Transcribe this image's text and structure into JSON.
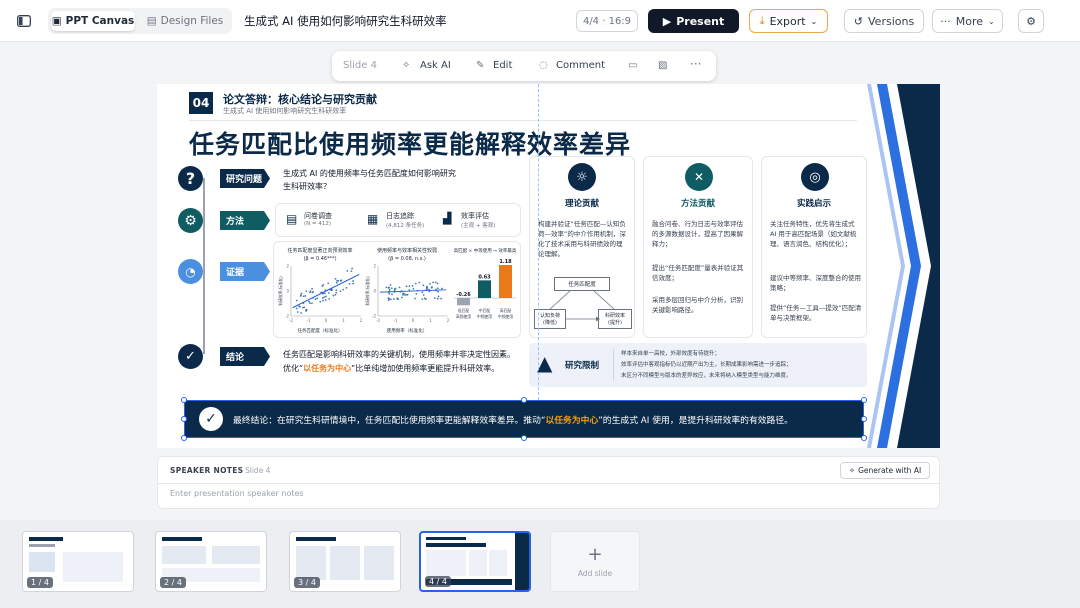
{
  "topbar": {
    "tab_canvas": "PPT Canvas",
    "tab_design": "Design Files",
    "doc_title": "生成式 AI 使用如何影响研究生科研效率",
    "page_info": "4/4 · 16:9",
    "present": "Present",
    "export": "Export",
    "versions": "Versions",
    "more": "More"
  },
  "toolbar": {
    "slide": "Slide 4",
    "ask": "Ask AI",
    "edit": "Edit",
    "comment": "Comment"
  },
  "slide": {
    "num": "04",
    "header_title": "论文答辩：核心结论与研究贡献",
    "header_sub": "生成式 AI 使用如何影响研究生科研效率",
    "main_title": "任务匹配比使用频率更能解释效率差异",
    "q_tag": "研究问题",
    "q_text": "生成式 AI 的使用频率与任务匹配度如何影响研究生科研效率？",
    "m_tag": "方法",
    "m1_title": "问卷调查",
    "m1_sub": "(N = 412)",
    "m2_title": "日志追踪",
    "m2_sub": "(4,812 条任务)",
    "m3_title": "效率评估",
    "m3_sub": "(主观 + 客观)",
    "e_tag": "证据",
    "ch1_title": "任务匹配度显著正向预测效率",
    "ch1_beta": "(β = 0.46***)",
    "ch1_x": "任务匹配度（标准化）",
    "ch1_y": "科研效率(标准化)",
    "ch2_title": "使用频率与效率相关性较弱",
    "ch2_beta": "(β = 0.08, n.s.)",
    "ch2_x": "使用频率（标准化）",
    "ch2_y": "科研效率(标准化)",
    "ch3_title": "高匹配 × 中等使用 → 效率最高",
    "c_tag": "结论",
    "c_text1": "任务匹配是影响科研效率的关键机制，使用频率并非决定性因素。",
    "c_text2a": "优化“",
    "c_text2b": "以任务为中心",
    "c_text2c": "”比单纯增加使用频率更能提升科研效率。",
    "t_title": "理论贡献",
    "t_text": "构建并验证“任务匹配—认知负荷—效率”的中介作用机制，深化了技术采用与科研绩效的理论理解。",
    "t_d1": "任务匹配度",
    "t_d2": "认知负荷\n(降低)",
    "t_d3": "科研效率\n(提升)",
    "mc_title": "方法贡献",
    "mc_1": "融合问卷、行为日志与效率评估的多源数据设计，提高了因果解释力；",
    "mc_2": "提出“任务匹配度”量表并验证其信效度；",
    "mc_3": "采用多层回归与中介分析，识别关键影响路径。",
    "p_title": "实践启示",
    "p_1": "关注任务特性，优先将生成式 AI 用于高匹配场景（如文献梳理、语言润色、结构优化）；",
    "p_2": "建议中等频率、深度整合的使用策略；",
    "p_3": "提供“任务—工具—提效”匹配清单与决策框架。",
    "lim_title": "研究限制",
    "lim_1": "样本来自单一高校，外部效度有待提升；",
    "lim_2": "效率评估中客观指标仍以近期产出为主，长期成果影响需进一步追踪；",
    "lim_3": "未区分不同模型与版本的差异效应，未来将纳入模型类型与能力维度。",
    "final_a": "最终结论：在研究生科研情境中，任务匹配比使用频率更能解释效率差异。推动“",
    "final_b": "以任务为中心",
    "final_c": "”的生成式 AI 使用，是提升科研效率的有效路径。"
  },
  "chart_data": [
    {
      "type": "scatter",
      "title": "任务匹配度显著正向预测效率",
      "subtitle": "(β = 0.46***)",
      "xlabel": "任务匹配度（标准化）",
      "ylabel": "科研效率(标准化)",
      "xlim": [
        -2,
        2
      ],
      "ylim": [
        -2,
        2
      ],
      "x_ticks": [
        -2,
        -1,
        0,
        1,
        2
      ],
      "y_ticks": [
        -2,
        0,
        2
      ],
      "trend": "positive"
    },
    {
      "type": "scatter",
      "title": "使用频率与效率相关性较弱",
      "subtitle": "(β = 0.08, n.s.)",
      "xlabel": "使用频率（标准化）",
      "ylabel": "科研效率(标准化)",
      "xlim": [
        -2,
        2
      ],
      "ylim": [
        -2,
        2
      ],
      "x_ticks": [
        -2,
        -1,
        0,
        1,
        2
      ],
      "y_ticks": [
        -2,
        0,
        2
      ],
      "trend": "flat"
    },
    {
      "type": "bar",
      "title": "高匹配 × 中等使用 → 效率最高",
      "categories": [
        "低匹配\n高频使用",
        "中匹配\n中频使用",
        "高匹配\n中频使用"
      ],
      "values": [
        -0.26,
        0.63,
        1.18
      ],
      "colors": [
        "#9ca3af",
        "#0f5c63",
        "#ea7a19"
      ]
    }
  ],
  "notes": {
    "label": "SPEAKER NOTES",
    "slide": "Slide 4",
    "gen": "Generate with AI",
    "placeholder": "Enter presentation speaker notes"
  },
  "film": {
    "t1": "1 / 4",
    "t2": "2 / 4",
    "t3": "3 / 4",
    "t4": "4 / 4",
    "add": "Add slide"
  }
}
